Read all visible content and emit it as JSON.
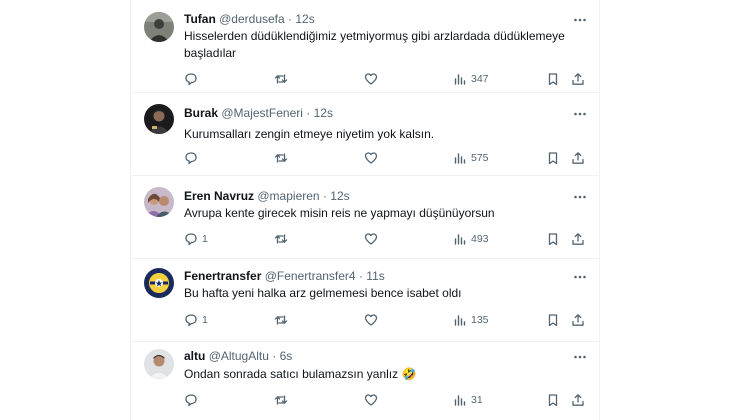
{
  "tweets": [
    {
      "name": "Tufan",
      "handle": "@derdusefa",
      "dot": "·",
      "time": "12s",
      "text": "Hisselerden düdüklendiğimiz yetmiyormuş gibi arzlardada düdüklemeye başladılar",
      "replies": "",
      "retweets": "",
      "likes": "",
      "views": "347",
      "avatar_icon": "man-in-grey-photo-avatar"
    },
    {
      "name": "Burak",
      "handle": "@MajestFeneri",
      "dot": "·",
      "time": "12s",
      "text": "Kurumsalları zengin etmeye niyetim yok kalsın.",
      "replies": "",
      "retweets": "",
      "likes": "",
      "views": "575",
      "avatar_icon": "man-on-dark-background-avatar"
    },
    {
      "name": "Eren Navruz",
      "handle": "@mapieren",
      "dot": "·",
      "time": "12s",
      "text": "Avrupa kente girecek misin reis ne yapmayı düşünüyorsun",
      "replies": "1",
      "retweets": "",
      "likes": "",
      "views": "493",
      "avatar_icon": "couple-photo-avatar"
    },
    {
      "name": "Fenertransfer",
      "handle": "@Fenertransfer4",
      "dot": "·",
      "time": "11s",
      "text": "Bu hafta yeni halka arz gelmemesi bence isabet oldı",
      "replies": "1",
      "retweets": "",
      "likes": "",
      "views": "135",
      "avatar_icon": "fenerbahce-badge-avatar"
    },
    {
      "name": "altu",
      "handle": "@AltugAltu",
      "dot": "·",
      "time": "6s",
      "text": "Ondan sonrada satıcı bulamazsın yanlız 🤣",
      "replies": "",
      "retweets": "",
      "likes": "",
      "views": "31",
      "avatar_icon": "man-photo-avatar"
    }
  ],
  "colors": {
    "text_primary": "#0f1419",
    "text_secondary": "#536471",
    "divider": "#eff3f4"
  },
  "icons": {
    "reply": "reply-icon",
    "retweet": "retweet-icon",
    "like": "heart-icon",
    "views": "views-chart-icon",
    "bookmark": "bookmark-icon",
    "share": "share-icon",
    "more": "more-dots-icon"
  }
}
